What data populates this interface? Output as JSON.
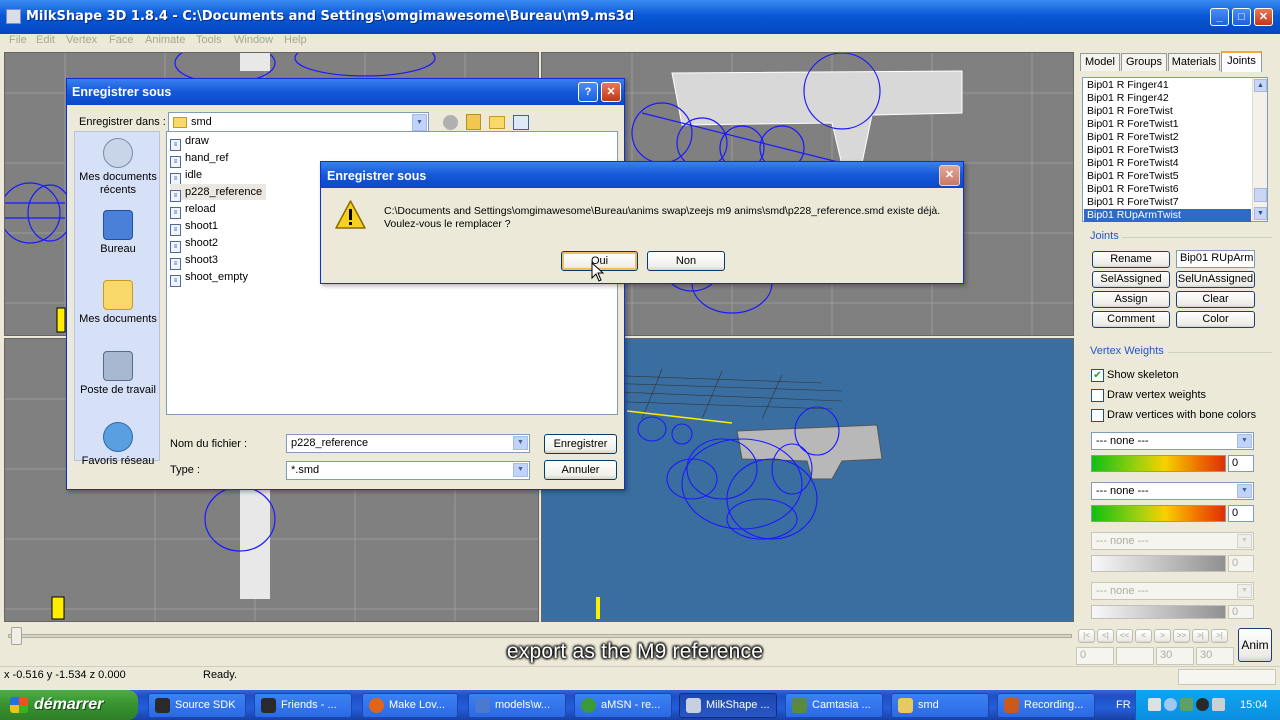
{
  "app": {
    "title": "MilkShape 3D 1.8.4 - C:\\Documents and Settings\\omgimawesome\\Bureau\\m9.ms3d",
    "window_buttons": {
      "minimize": "_",
      "maximize": "□",
      "close": "✕"
    }
  },
  "menu": [
    "File",
    "Edit",
    "Vertex",
    "Face",
    "Animate",
    "Tools",
    "Window",
    "Help"
  ],
  "panel": {
    "tabs": [
      "Model",
      "Groups",
      "Materials",
      "Joints"
    ],
    "active_tab": "Joints",
    "joints_list": [
      "Bip01 R Finger41",
      "Bip01 R Finger42",
      "Bip01 R ForeTwist",
      "Bip01 R ForeTwist1",
      "Bip01 R ForeTwist2",
      "Bip01 R ForeTwist3",
      "Bip01 R ForeTwist4",
      "Bip01 R ForeTwist5",
      "Bip01 R ForeTwist6",
      "Bip01 R ForeTwist7",
      "Bip01 RUpArmTwist"
    ],
    "selected_joint_index": 10,
    "joints_group": "Joints",
    "rename_label": "Rename",
    "joint_name_value": "Bip01 RUpArm",
    "selassigned_label": "SelAssigned",
    "selunassigned_label": "SelUnAssigned",
    "assign_label": "Assign",
    "clear_label": "Clear",
    "comment_label": "Comment",
    "color_label": "Color",
    "vertex_weights_group": "Vertex Weights",
    "show_skeleton": {
      "label": "Show skeleton",
      "checked": true
    },
    "draw_vertex_weights": {
      "label": "Draw vertex weights",
      "checked": false
    },
    "draw_vertices_bone_colors": {
      "label": "Draw vertices with bone colors",
      "checked": false
    },
    "weights": [
      {
        "joint": "--- none ---",
        "value": "0",
        "enabled": true
      },
      {
        "joint": "--- none ---",
        "value": "0",
        "enabled": true
      },
      {
        "joint": "--- none ---",
        "value": "0",
        "enabled": false
      },
      {
        "joint": "--- none ---",
        "value": "0",
        "enabled": false
      }
    ]
  },
  "timeline": {
    "anim_label": "Anim",
    "frame_fields": [
      "0",
      "",
      "30",
      "30"
    ],
    "nav_buttons": [
      "|<",
      "<|",
      "<<",
      "<",
      ">",
      ">>",
      ">|",
      ">|"
    ]
  },
  "status": {
    "coords": "x -0.516 y -1.534 z 0.000",
    "text": "Ready."
  },
  "save_dialog": {
    "title": "Enregistrer sous",
    "help": "?",
    "close": "✕",
    "save_in_label": "Enregistrer dans :",
    "save_in_value": "smd",
    "places": [
      "Mes documents récents",
      "Bureau",
      "Mes documents",
      "Poste de travail",
      "Favoris réseau"
    ],
    "files": [
      "draw",
      "hand_ref",
      "idle",
      "p228_reference",
      "reload",
      "shoot1",
      "shoot2",
      "shoot3",
      "shoot_empty"
    ],
    "highlighted_file_index": 3,
    "file_icon": "smd-file-icon",
    "filename_label": "Nom du fichier :",
    "filename_value": "p228_reference",
    "type_label": "Type :",
    "type_value": "*.smd",
    "save_button": "Enregistrer",
    "cancel_button": "Annuler"
  },
  "confirm_dialog": {
    "title": "Enregistrer sous",
    "close": "✕",
    "message_line1": "C:\\Documents and Settings\\omgimawesome\\Bureau\\anims swap\\zeejs m9 anims\\smd\\p228_reference.smd existe déjà.",
    "message_line2": "Voulez-vous le remplacer ?",
    "icon": "warning-icon",
    "yes_button": "Oui",
    "no_button": "Non"
  },
  "caption": "export as the M9 reference",
  "taskbar": {
    "start_label": "démarrer",
    "buttons": [
      {
        "label": "Source SDK",
        "active": false,
        "color": "#2a2a2a"
      },
      {
        "label": "Friends - ...",
        "active": false,
        "color": "#2a2a2a"
      },
      {
        "label": "Make Lov...",
        "active": false,
        "color": "#e0641a"
      },
      {
        "label": "models\\w...",
        "active": false,
        "color": "#4a7ad0"
      },
      {
        "label": "aMSN - re...",
        "active": false,
        "color": "#3a9a3a"
      },
      {
        "label": "MilkShape ...",
        "active": true,
        "color": "#c8d0e0"
      },
      {
        "label": "Camtasia ...",
        "active": false,
        "color": "#5a8a3a"
      },
      {
        "label": "smd",
        "active": false,
        "color": "#e8c860"
      },
      {
        "label": "Recording...",
        "active": false,
        "color": "#c85a20"
      }
    ],
    "language": "FR",
    "clock": "15:04"
  },
  "colors": {
    "viewport_grey": "#808080",
    "viewport_blue": "#3a6ea0",
    "wireframe": "#1a1aff",
    "selection": "#316ac5",
    "xp_title": "#0a58d8"
  }
}
